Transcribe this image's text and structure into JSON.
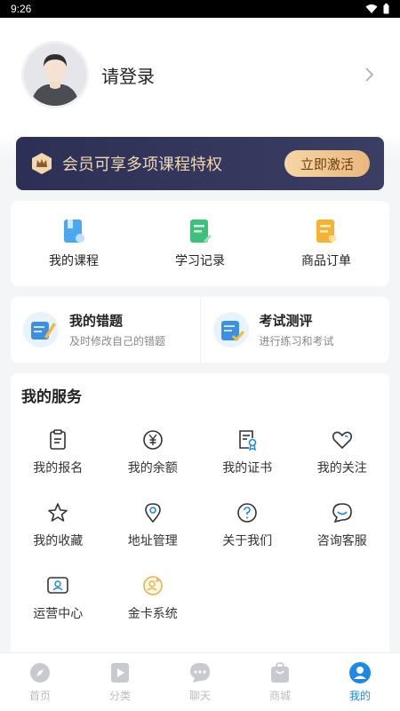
{
  "status": {
    "time": "9:26"
  },
  "profile": {
    "login_text": "请登录"
  },
  "vip": {
    "text": "会员可享多项课程特权",
    "button": "立即激活"
  },
  "quick": [
    {
      "label": "我的课程",
      "icon": "bookmark-doc-icon"
    },
    {
      "label": "学习记录",
      "icon": "record-edit-icon"
    },
    {
      "label": "商品订单",
      "icon": "order-doc-icon"
    }
  ],
  "practice": [
    {
      "title": "我的错题",
      "subtitle": "及时修改自己的错题",
      "icon": "notebook-pencil-icon"
    },
    {
      "title": "考试测评",
      "subtitle": "进行练习和考试",
      "icon": "exam-check-icon"
    }
  ],
  "services": {
    "title": "我的服务",
    "items": [
      {
        "label": "我的报名",
        "icon": "clipboard-icon"
      },
      {
        "label": "我的余额",
        "icon": "yen-coin-icon"
      },
      {
        "label": "我的证书",
        "icon": "certificate-icon"
      },
      {
        "label": "我的关注",
        "icon": "heart-icon"
      },
      {
        "label": "我的收藏",
        "icon": "star-icon"
      },
      {
        "label": "地址管理",
        "icon": "location-pin-icon"
      },
      {
        "label": "关于我们",
        "icon": "question-circle-icon"
      },
      {
        "label": "咨询客服",
        "icon": "chat-smile-icon"
      },
      {
        "label": "运营中心",
        "icon": "operations-icon"
      },
      {
        "label": "金卡系统",
        "icon": "gold-card-icon"
      }
    ]
  },
  "tabs": [
    {
      "label": "首页",
      "icon": "compass-icon",
      "active": false
    },
    {
      "label": "分类",
      "icon": "play-category-icon",
      "active": false
    },
    {
      "label": "聊天",
      "icon": "chat-bubble-icon",
      "active": false
    },
    {
      "label": "商城",
      "icon": "shopping-bag-icon",
      "active": false
    },
    {
      "label": "我的",
      "icon": "user-icon",
      "active": true
    }
  ],
  "colors": {
    "accent": "#1e88e5",
    "vip_bg": "#2c3055",
    "vip_text": "#f2d7b0",
    "vip_button": "#eab77d"
  }
}
